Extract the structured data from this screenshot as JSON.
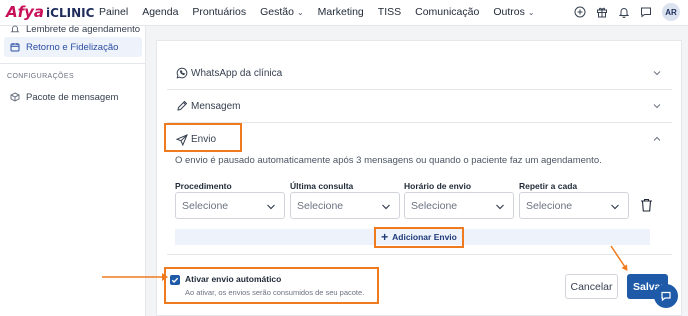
{
  "brand": {
    "afya": "Afya",
    "iclinic": "iCLINIC"
  },
  "nav": [
    {
      "label": "Painel",
      "dropdown": false
    },
    {
      "label": "Agenda",
      "dropdown": false
    },
    {
      "label": "Prontuários",
      "dropdown": false
    },
    {
      "label": "Gestão",
      "dropdown": true
    },
    {
      "label": "Marketing",
      "dropdown": false
    },
    {
      "label": "TISS",
      "dropdown": false
    },
    {
      "label": "Comunicação",
      "dropdown": false
    },
    {
      "label": "Outros",
      "dropdown": true
    }
  ],
  "user": {
    "initials": "AR"
  },
  "sidebar": {
    "items": [
      {
        "label": "Lembrete de agendamento",
        "icon": "bell-icon"
      },
      {
        "label": "Retorno e Fidelização",
        "icon": "calendar-icon",
        "active": true
      }
    ],
    "section_title": "CONFIGURAÇÕES",
    "settings_items": [
      {
        "label": "Pacote de mensagem",
        "icon": "package-icon"
      }
    ]
  },
  "sections": {
    "whatsapp": "WhatsApp da clínica",
    "mensagem": "Mensagem",
    "envio": "Envio"
  },
  "envio": {
    "description": "O envio é pausado automaticamente após 3 mensagens ou quando o paciente faz um agendamento.",
    "columns": [
      "Procedimento",
      "Última consulta",
      "Horário de envio",
      "Repetir a cada"
    ],
    "select_placeholder": "Selecione",
    "add_label": "Adicionar Envio"
  },
  "auto_send": {
    "label": "Ativar envio automático",
    "help": "Ao ativar, os envios serão consumidos de seu pacote.",
    "checked": true
  },
  "actions": {
    "cancel": "Cancelar",
    "save": "Salvar"
  },
  "colors": {
    "accent": "#1f5aa8",
    "highlight": "#f07b1f",
    "brand": "#c8105a"
  }
}
